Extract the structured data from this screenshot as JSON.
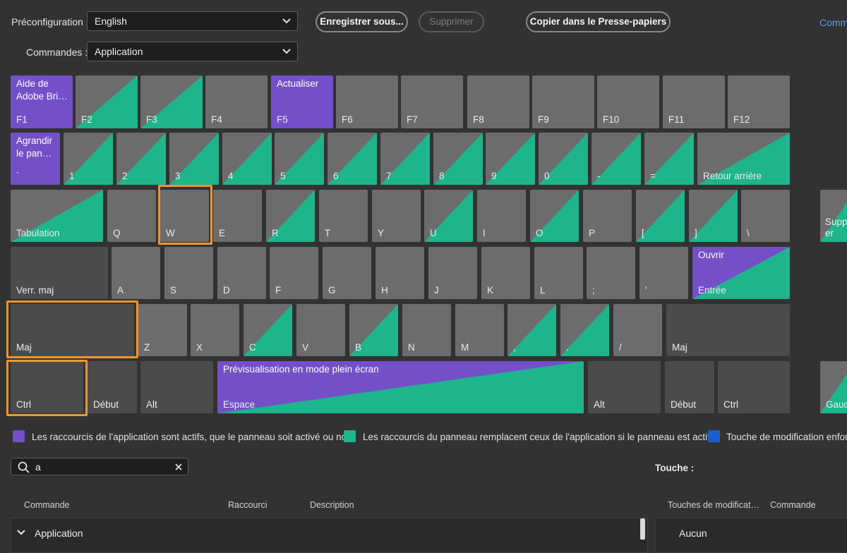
{
  "toolbar": {
    "preset_label": "Préconfiguration :",
    "preset_value": "English",
    "commands_label": "Commandes :",
    "commands_value": "Application",
    "save_as": "Enregistrer sous...",
    "delete": "Supprimer",
    "copy_clipboard": "Copier dans le Presse-papiers",
    "truncated_link": "Comm"
  },
  "keys": {
    "f1_top": "Aide de Adobe Bri…",
    "f1": "F1",
    "f2": "F2",
    "f3": "F3",
    "f4": "F4",
    "f5_top": "Actualiser",
    "f5": "F5",
    "f6": "F6",
    "f7": "F7",
    "f8": "F8",
    "f9": "F9",
    "f10": "F10",
    "f11": "F11",
    "f12": "F12",
    "grave_top": "Agrandir le pan…",
    "grave": "`",
    "k1": "1",
    "k2": "2",
    "k3": "3",
    "k4": "4",
    "k5": "5",
    "k6": "6",
    "k7": "7",
    "k8": "8",
    "k9": "9",
    "k0": "0",
    "minus": "-",
    "equal": "=",
    "backspace": "Retour arrière",
    "tab": "Tabulation",
    "q": "Q",
    "w": "W",
    "e": "E",
    "r": "R",
    "t": "T",
    "y": "Y",
    "u": "U",
    "i": "I",
    "o": "O",
    "p": "P",
    "lbracket": "[",
    "rbracket": "]",
    "backslash": "\\",
    "delete_key": "Supprim er",
    "caps": "Verr. maj",
    "a": "A",
    "s": "S",
    "d": "D",
    "f": "F",
    "g": "G",
    "h": "H",
    "j": "J",
    "k": "K",
    "l": "L",
    "semicolon": ";",
    "quote": "'",
    "enter_top": "Ouvrir",
    "enter": "Entrée",
    "shift_l": "Maj",
    "z": "Z",
    "x": "X",
    "c": "C",
    "v": "V",
    "b": "B",
    "n": "N",
    "m": "M",
    "comma": ",",
    "period": ".",
    "slash": "/",
    "shift_r": "Maj",
    "ctrl_l": "Ctrl",
    "home_l": "Début",
    "alt_l": "Alt",
    "space_top": "Prévisualisation en mode plein écran",
    "space": "Espace",
    "alt_r": "Alt",
    "home_r": "Début",
    "ctrl_r": "Ctrl",
    "left_arrow": "Gauc"
  },
  "legend": {
    "app": "Les raccourcis de l'application sont actifs, que le panneau soit activé ou non.",
    "panel": "Les raccourcis du panneau remplacent ceux de l'application si le panneau est activé.",
    "modifier": "Touche de modification enfon",
    "colors": {
      "app": "#7350c8",
      "panel": "#1eb48c",
      "modifier": "#1a5fd0"
    }
  },
  "search": {
    "value": "a"
  },
  "key_section": {
    "label": "Touche :"
  },
  "table": {
    "headers": {
      "command": "Commande",
      "shortcut": "Raccourci",
      "description": "Description"
    },
    "group": "Application"
  },
  "right_table": {
    "headers": {
      "modifiers": "Touches de modificat…",
      "command": "Commande"
    },
    "row": "Aucun"
  }
}
